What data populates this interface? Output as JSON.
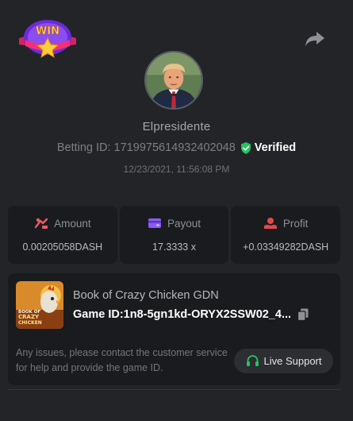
{
  "badge": {
    "text": "WIN"
  },
  "profile": {
    "username": "Elpresidente",
    "betting_id_label": "Betting ID: 1719975614932402048",
    "verified_label": "Verified",
    "date": "12/23/2021, 11:56:08 PM"
  },
  "stats": [
    {
      "label": "Amount",
      "value": "0.00205058DASH",
      "icon": "amount-icon"
    },
    {
      "label": "Payout",
      "value": "17.3333 x",
      "icon": "payout-icon"
    },
    {
      "label": "Profit",
      "value": "+0.03349282DASH",
      "icon": "profit-icon"
    }
  ],
  "game": {
    "name": "Book of Crazy Chicken GDN",
    "id_text": "Game ID:1n8-5gn1kd-ORYX2SSW02_4...",
    "thumb_text": [
      "BOOK OF",
      "CRAZY",
      "CHICKEN"
    ]
  },
  "support": {
    "text": "Any issues, please contact the customer service for help and provide the game ID.",
    "button_label": "Live Support"
  },
  "colors": {
    "background": "#232427",
    "card": "#1a1b1e",
    "verified_green": "#22c55e",
    "amount_red": "#e85a63",
    "payout_purple": "#8a5cf6",
    "profit_red": "#e24a4a",
    "support_green": "#22c55e"
  }
}
